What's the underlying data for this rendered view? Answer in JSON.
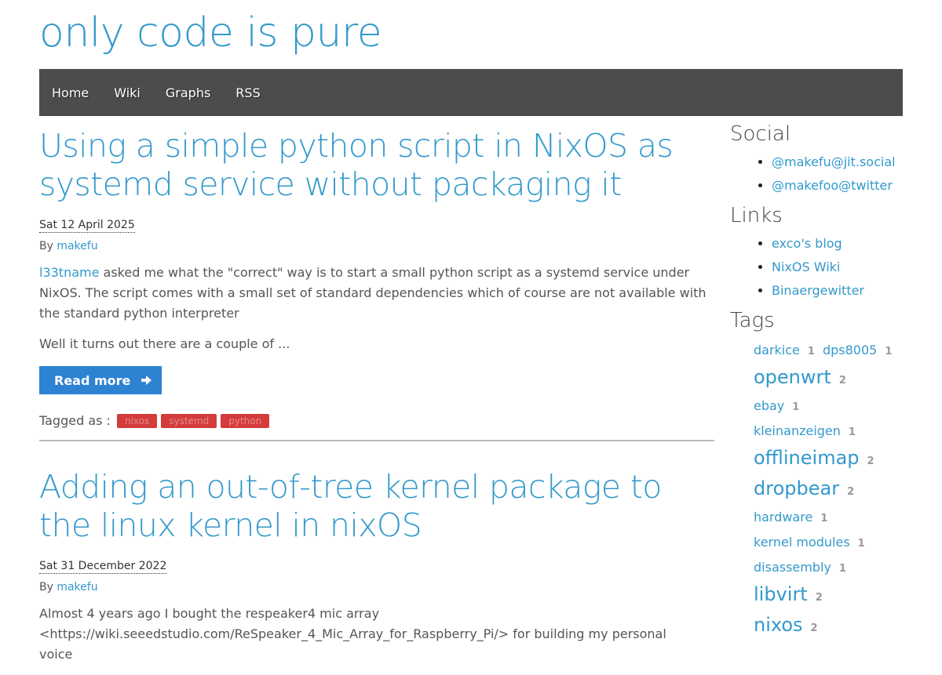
{
  "site": {
    "title": "only code is pure"
  },
  "nav": {
    "items": [
      "Home",
      "Wiki",
      "Graphs",
      "RSS"
    ]
  },
  "articles": [
    {
      "title": "Using a simple python script in NixOS as systemd service without packaging it",
      "date": "Sat 12 April 2025",
      "by_label": "By",
      "author": "makefu",
      "body_link": "l33tname",
      "body_1_rest": " asked me what the \"correct\" way is to start a small python script as a systemd service under NixOS. The script comes with a small set of standard dependencies which of course are not available with the standard python interpreter",
      "body_2": "Well it turns out there are a couple of ...",
      "read_more": "Read more",
      "tagged_label": "Tagged as :",
      "tags": [
        "nixos",
        "systemd",
        "python"
      ]
    },
    {
      "title": "Adding an out-of-tree kernel package to the linux kernel in nixOS",
      "date": "Sat 31 December 2022",
      "by_label": "By",
      "author": "makefu",
      "body_1": "Almost 4 years ago I bought the respeaker4 mic array <https://wiki.seeedstudio.com/ReSpeaker_4_Mic_Array_for_Raspberry_Pi/> for building my personal voice"
    }
  ],
  "sidebar": {
    "social_heading": "Social",
    "social": [
      "@makefu@jit.social",
      "@makefoo@twitter"
    ],
    "links_heading": "Links",
    "links": [
      "exco's blog",
      "NixOS Wiki",
      "Binaergewitter"
    ],
    "tags_heading": "Tags",
    "tags": [
      {
        "name": "darkice",
        "count": "1",
        "size": 1
      },
      {
        "name": "dps8005",
        "count": "1",
        "size": 1
      },
      {
        "name": "openwrt",
        "count": "2",
        "size": 2
      },
      {
        "name": "ebay",
        "count": "1",
        "size": 1
      },
      {
        "name": "kleinanzeigen",
        "count": "1",
        "size": 1
      },
      {
        "name": "offlineimap",
        "count": "2",
        "size": 2
      },
      {
        "name": "dropbear",
        "count": "2",
        "size": 2
      },
      {
        "name": "hardware",
        "count": "1",
        "size": 1
      },
      {
        "name": "kernel modules",
        "count": "1",
        "size": 1
      },
      {
        "name": "disassembly",
        "count": "1",
        "size": 1
      },
      {
        "name": "libvirt",
        "count": "2",
        "size": 2
      },
      {
        "name": "nixos",
        "count": "2",
        "size": 2
      }
    ]
  },
  "colors": {
    "accent": "#3399cc",
    "navbar": "#4a4c4e",
    "button": "#2d82d2",
    "tag_badge": "#d43b3b"
  }
}
